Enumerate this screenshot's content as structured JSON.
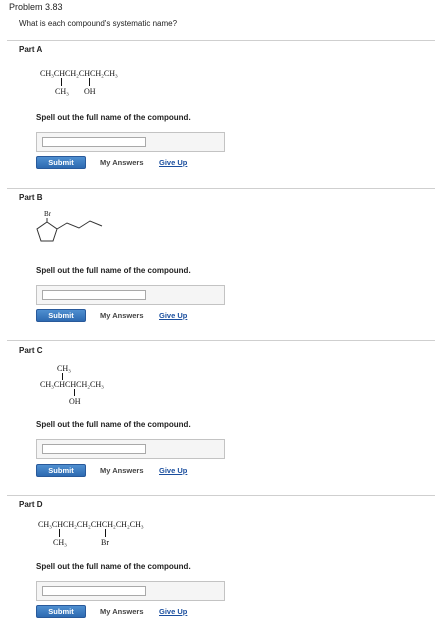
{
  "problem_title": "Problem 3.83",
  "question": "What is each compound's systematic name?",
  "instruction": "Spell out the full name of the compound.",
  "buttons": {
    "submit": "Submit",
    "my_answers": "My Answers",
    "give_up": "Give Up"
  },
  "parts": [
    {
      "title": "Part A",
      "formula": {
        "main": "CH₃CHCH₂CHCH₂CH₃",
        "sub1": "CH₃",
        "sub2": "OH"
      },
      "answer": ""
    },
    {
      "title": "Part B",
      "formula": {
        "label": "Br"
      },
      "answer": ""
    },
    {
      "title": "Part C",
      "formula": {
        "top": "CH₃",
        "main": "CH₃CHCHCH₂CH₃",
        "bottom": "OH"
      },
      "answer": ""
    },
    {
      "title": "Part D",
      "formula": {
        "main": "CH₃CHCH₂CH₂CHCH₂CH₂CH₃",
        "sub1": "CH₃",
        "sub2": "Br"
      },
      "answer": ""
    }
  ]
}
